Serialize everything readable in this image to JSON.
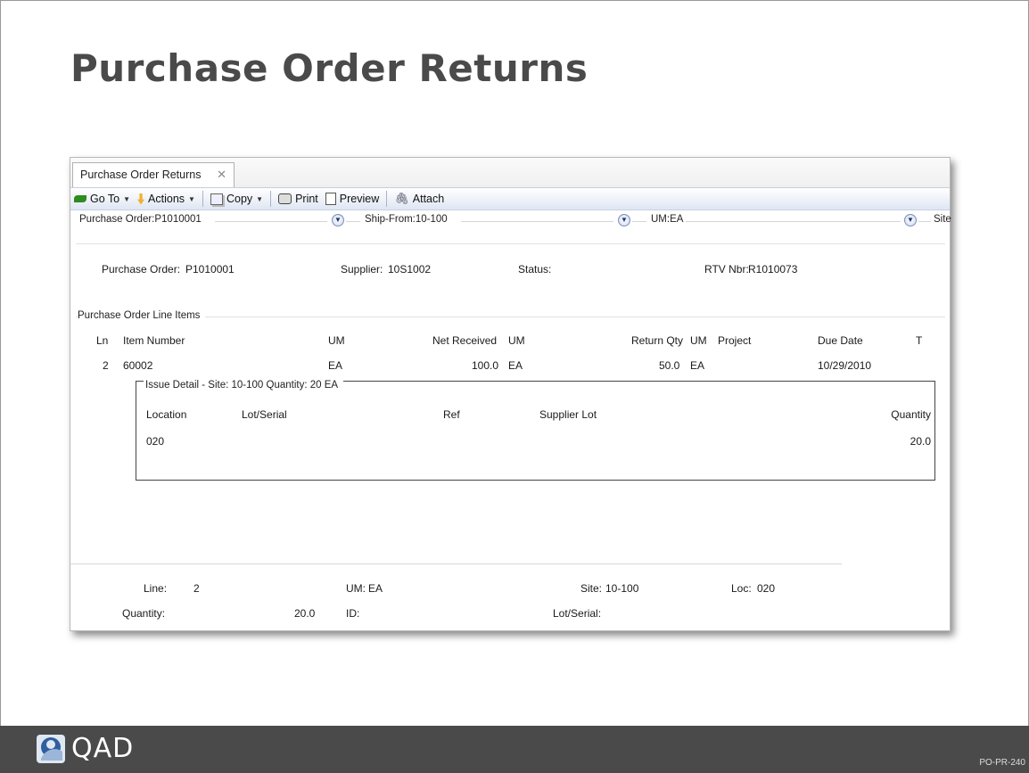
{
  "slide": {
    "title": "Purchase Order Returns",
    "slide_code": "PO-PR-240",
    "logo_text": "QAD"
  },
  "window": {
    "tab_label": "Purchase Order Returns",
    "tab_close": "✕",
    "toolbar": {
      "goto_label": "Go To",
      "actions_label": "Actions",
      "copy_label": "Copy",
      "print_label": "Print",
      "preview_label": "Preview",
      "attach_label": "Attach"
    },
    "filters": {
      "purchase_order": "Purchase Order:P1010001",
      "ship_from": "Ship-From:10-100",
      "um": "UM:EA",
      "site": "Site"
    }
  },
  "header": {
    "purchase_order_label": "Purchase Order:",
    "purchase_order_value": "P1010001",
    "supplier_label": "Supplier:",
    "supplier_value": "10S1002",
    "status_label": "Status:",
    "rtv_label": "RTV Nbr:",
    "rtv_value": "R1010073"
  },
  "line_items": {
    "section_title": "Purchase Order Line Items",
    "columns": {
      "ln": "Ln",
      "item_number": "Item Number",
      "um": "UM",
      "net_received": "Net Received",
      "net_um": "UM",
      "return_qty": "Return Qty",
      "return_um": "UM",
      "project": "Project",
      "due_date": "Due Date",
      "t": "T"
    },
    "rows": [
      {
        "ln": "2",
        "item_number": "60002",
        "um": "EA",
        "net_received": "100.0",
        "net_um": "EA",
        "return_qty": "50.0",
        "return_um": "EA",
        "project": "",
        "due_date": "10/29/2010",
        "t": ""
      }
    ]
  },
  "issue_detail": {
    "title": "Issue Detail - Site: 10-100 Quantity: 20 EA",
    "columns": {
      "location": "Location",
      "lot_serial": "Lot/Serial",
      "ref": "Ref",
      "supplier_lot": "Supplier Lot",
      "quantity": "Quantity"
    },
    "rows": [
      {
        "location": "020",
        "lot_serial": "",
        "ref": "",
        "supplier_lot": "",
        "quantity": "20.0"
      }
    ]
  },
  "footer": {
    "line_label": "Line:",
    "line_value": "2",
    "um_label": "UM:",
    "um_value": "EA",
    "site_label": "Site:",
    "site_value": "10-100",
    "loc_label": "Loc:",
    "loc_value": "020",
    "quantity_label": "Quantity:",
    "quantity_value": "20.0",
    "id_label": "ID:",
    "lot_serial_label": "Lot/Serial:"
  },
  "colors": {
    "footer_bar": "#4a4a4a",
    "title_text": "#4a4a4a",
    "toolbar_gradient_end": "#dfe6f3"
  }
}
